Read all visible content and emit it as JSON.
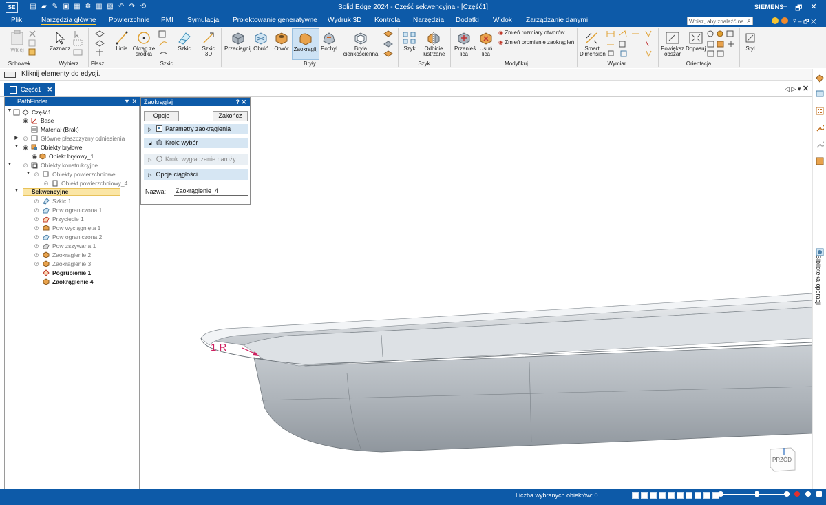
{
  "app": {
    "logo": "SE",
    "title": "Solid Edge 2024 - Część sekwencyjna - [Część1]",
    "brand": "SIEMENS",
    "window_controls": [
      "–",
      "🗗",
      "✕"
    ],
    "accent_color": "#0d5aa8"
  },
  "menu": {
    "tabs": [
      "Plik",
      "Narzędzia główne",
      "Powierzchnie",
      "PMI",
      "Symulacja",
      "Projektowanie generatywne",
      "Wydruk 3D",
      "Kontrola",
      "Narzędzia",
      "Dodatki",
      "Widok",
      "Zarządzanie danymi"
    ],
    "active_tab": "Narzędzia główne",
    "search_placeholder": "Wpisz, aby znaleźć na",
    "extras": "? – 🗗 ✕"
  },
  "ribbon": {
    "buttons": {
      "wklej": "Wklej",
      "zaznacz": "Zaznacz",
      "linia": "Linia",
      "okrag": "Okrąg ze środka",
      "szkic": "Szkic",
      "szkic3d": "Szkic 3D",
      "przeciagnij": "Przeciągnij",
      "obroc": "Obróć",
      "otwor": "Otwór",
      "zaokraglij": "Zaokrąglij",
      "pochyl": "Pochyl",
      "bryla": "Bryła cienkościenna",
      "szyk": "Szyk",
      "odbicie": "Odbicie lustrzane",
      "przenies": "Przenieś lica",
      "usun": "Usuń lica",
      "zmien_otw": "Zmień rozmiary otworów",
      "zmien_zaokr": "Zmień promienie zaokrągleń",
      "smart": "Smart Dimension",
      "powieksz": "Powiększ obszar",
      "dopasuj": "Dopasuj",
      "styl": "Styl"
    },
    "groups": {
      "schowek": "Schowek",
      "wybierz": "Wybierz",
      "plasz": "Płasz...",
      "szkic": "Szkic",
      "bryly": "Bryły",
      "szyk": "Szyk",
      "modyfikuj": "Modyfikuj",
      "wymiar": "Wymiar",
      "orientacja": "Orientacja"
    }
  },
  "command_bar": {
    "message": "Kliknij elementy do edycji."
  },
  "doc_tab": {
    "label": "Część1"
  },
  "pathfinder": {
    "title": "PathFinder",
    "tree": {
      "root": "Część1",
      "base": "Base",
      "material": "Materiał (Brak)",
      "planes": "Główne płaszczyzny odniesienia",
      "solid_bodies": "Obiekty bryłowe",
      "solid_body_1": "Obiekt bryłowy_1",
      "construction": "Obiekty konstrukcyjne",
      "surface_bodies": "Obiekty powierzchniowe",
      "surface_body_4": "Obiekt powierzchniowy_4",
      "sequential": "Sekwencyjne",
      "features": [
        "Szkic 1",
        "Pow ograniczona 1",
        "Przycięcie 1",
        "Pow wyciągnięta 1",
        "Pow ograniczona 2",
        "Pow zszywana 1",
        "Zaokrąglenie 2",
        "Zaokrąglenie 3",
        "Pogrubienie 1",
        "Zaokrąglenie 4"
      ]
    }
  },
  "dialog": {
    "title": "Zaokrąglaj",
    "opcje": "Opcje",
    "zakoncz": "Zakończ",
    "sections": [
      "Parametry zaokrąglenia",
      "Krok: wybór",
      "Krok: wygładzanie naroży",
      "Opcje ciągłości"
    ],
    "name_label": "Nazwa:",
    "name_value": "Zaokrąglenie_4"
  },
  "viewport": {
    "dimension_label": "1 R",
    "viewcube_label": "PRZÓD"
  },
  "right_bar": {
    "vertical_label": "Biblioteka operacji"
  },
  "status": {
    "selected_count_label": "Liczba wybranych obiektów: 0"
  }
}
